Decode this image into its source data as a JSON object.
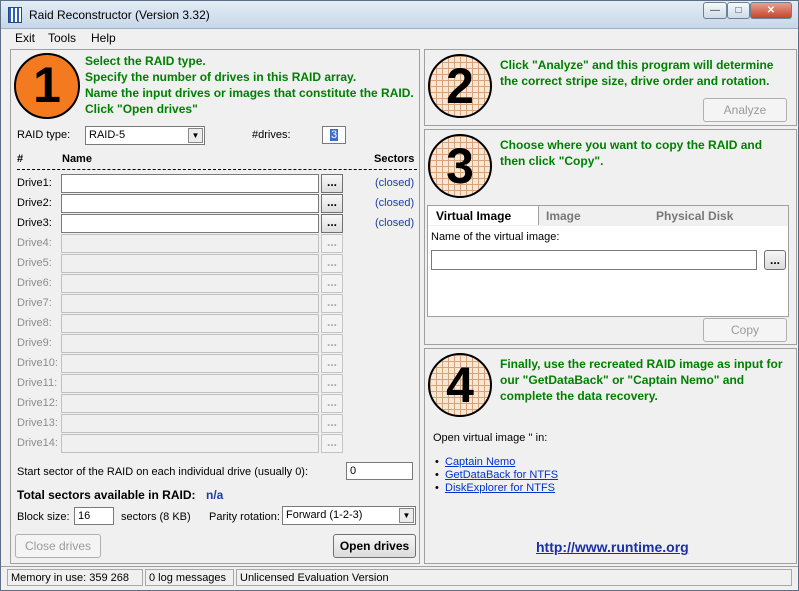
{
  "window": {
    "title": "Raid Reconstructor (Version 3.32)"
  },
  "menu": [
    "Exit",
    "Tools",
    "Help"
  ],
  "step1": {
    "number": "1",
    "lines": [
      "Select the RAID type.",
      "Specify the number of drives in this RAID array.",
      "Name the input drives or images that constitute the RAID.",
      "Click \"Open drives\""
    ],
    "raid_type_label": "RAID type:",
    "raid_type_value": "RAID-5",
    "drives_label": "#drives:",
    "drives_value": "3",
    "col_num": "#",
    "col_name": "Name",
    "col_sectors": "Sectors",
    "drives": [
      {
        "label": "Drive1:",
        "status": "(closed)",
        "enabled": true
      },
      {
        "label": "Drive2:",
        "status": "(closed)",
        "enabled": true
      },
      {
        "label": "Drive3:",
        "status": "(closed)",
        "enabled": true
      },
      {
        "label": "Drive4:",
        "status": "",
        "enabled": false
      },
      {
        "label": "Drive5:",
        "status": "",
        "enabled": false
      },
      {
        "label": "Drive6:",
        "status": "",
        "enabled": false
      },
      {
        "label": "Drive7:",
        "status": "",
        "enabled": false
      },
      {
        "label": "Drive8:",
        "status": "",
        "enabled": false
      },
      {
        "label": "Drive9:",
        "status": "",
        "enabled": false
      },
      {
        "label": "Drive10:",
        "status": "",
        "enabled": false
      },
      {
        "label": "Drive11:",
        "status": "",
        "enabled": false
      },
      {
        "label": "Drive12:",
        "status": "",
        "enabled": false
      },
      {
        "label": "Drive13:",
        "status": "",
        "enabled": false
      },
      {
        "label": "Drive14:",
        "status": "",
        "enabled": false
      }
    ],
    "browse_label": "...",
    "start_sector_label": "Start sector of the RAID on each individual drive (usually 0):",
    "start_sector_value": "0",
    "total_sectors_label": "Total sectors available in RAID:",
    "total_sectors_value": "n/a",
    "block_size_label": "Block size:",
    "block_size_value": "16",
    "block_size_unit": "sectors (8 KB)",
    "parity_label": "Parity rotation:",
    "parity_value": "Forward (1-2-3)",
    "close_drives": "Close drives",
    "open_drives": "Open drives"
  },
  "step2": {
    "number": "2",
    "text": "Click \"Analyze\" and this program will determine the correct stripe size, drive order and rotation.",
    "analyze": "Analyze"
  },
  "step3": {
    "number": "3",
    "text": "Choose where you want to copy the RAID and then click \"Copy\".",
    "tabs": [
      "Virtual Image",
      "Image",
      "Physical Disk"
    ],
    "name_label": "Name of the virtual image:",
    "browse_label": "...",
    "copy": "Copy"
  },
  "step4": {
    "number": "4",
    "text": "Finally, use the recreated RAID image as input for our \"GetDataBack\" or \"Captain Nemo\" and complete the data recovery.",
    "open_label": "Open virtual image '' in:",
    "links": [
      "Captain Nemo",
      "GetDataBack for NTFS",
      "DiskExplorer for NTFS"
    ],
    "url": "http://www.runtime.org"
  },
  "status": {
    "memory": "Memory in use: 359 268",
    "log": "0 log messages",
    "license": "Unlicensed Evaluation Version"
  },
  "colors": {
    "step_text": "#008000",
    "badge_orange": "#f47a20",
    "link": "#0033cc"
  }
}
